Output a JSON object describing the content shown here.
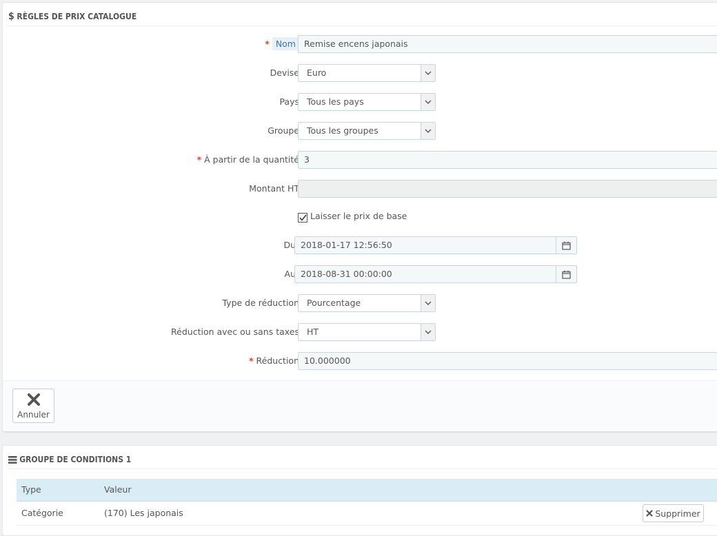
{
  "rules_panel": {
    "title": "RÈGLES DE PRIX CATALOGUE",
    "fields": {
      "name": {
        "label": "Nom",
        "value": "Remise encens japonais"
      },
      "currency": {
        "label": "Devise",
        "value": "Euro"
      },
      "country": {
        "label": "Pays",
        "value": "Tous les pays"
      },
      "group": {
        "label": "Groupe",
        "value": "Tous les groupes"
      },
      "from_quantity": {
        "label": "À partir de la quantité",
        "value": "3"
      },
      "amount_excl_tax": {
        "label": "Montant HT",
        "value": ""
      },
      "keep_base_price": {
        "label": "Laisser le prix de base",
        "checked": true
      },
      "from_date": {
        "label": "Du",
        "value": "2018-01-17 12:56:50"
      },
      "to_date": {
        "label": "Au",
        "value": "2018-08-31 00:00:00"
      },
      "reduction_type": {
        "label": "Type de réduction",
        "value": "Pourcentage"
      },
      "reduction_tax": {
        "label": "Réduction avec ou sans taxes",
        "value": "HT"
      },
      "reduction": {
        "label": "Réduction",
        "value": "10.000000"
      }
    },
    "required_mark": "*",
    "cancel_label": "Annuler"
  },
  "conditions_panel": {
    "title": "GROUPE DE CONDITIONS 1",
    "columns": {
      "type": "Type",
      "value": "Valeur"
    },
    "rows": [
      {
        "type": "Catégorie",
        "value": "(170) Les japonais",
        "delete_label": "Supprimer"
      }
    ]
  },
  "icons": {
    "dollar": "dollar-icon",
    "list": "list-icon",
    "calendar": "calendar-icon",
    "close": "close-icon",
    "chevron": "chevron-down-icon",
    "check": "check-icon"
  },
  "colors": {
    "required": "#e04040",
    "table_header_bg": "#d9edf7",
    "highlight_label": "#3a76a8"
  }
}
